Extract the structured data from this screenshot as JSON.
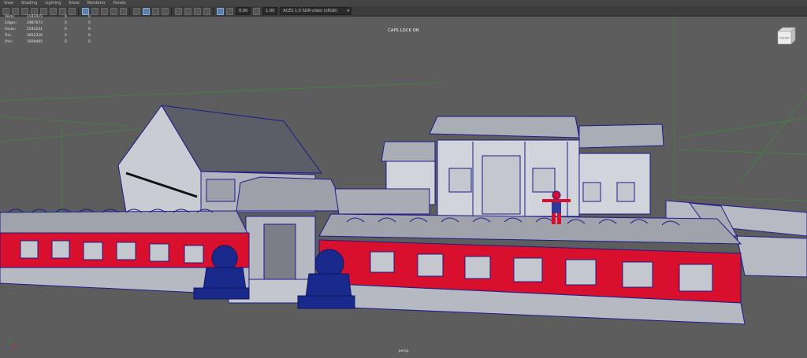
{
  "menu": [
    "View",
    "Shading",
    "Lighting",
    "Show",
    "Renderer",
    "Panels"
  ],
  "toolbar": {
    "field_a": "0.00",
    "field_b": "1.00",
    "color_space": "ACES 1.0 SDR-video (sRGB)",
    "icons": [
      "camera-icon",
      "grid-icon",
      "bookmark-icon",
      "image-plane-icon",
      "film-gate-icon",
      "resolution-gate-icon",
      "safe-action-icon",
      "field-chart-icon",
      "wireframe-icon",
      "smooth-shade-icon",
      "textured-icon",
      "lights-icon",
      "shadows-icon",
      "ambient-occlusion-icon",
      "motion-blur-icon",
      "antialias-icon",
      "isolate-select-icon",
      "xray-icon",
      "xray-joints-icon",
      "backface-icon",
      "exposure-icon",
      "gamma-icon",
      "color-manage-icon"
    ]
  },
  "hud": {
    "rows": [
      {
        "label": "Verts:",
        "v1": "1542415",
        "v2": "0",
        "v3": "0"
      },
      {
        "label": "Edges:",
        "v1": "2987673",
        "v2": "0",
        "v3": "0"
      },
      {
        "label": "Faces:",
        "v1": "1545241",
        "v2": "0",
        "v3": "0"
      },
      {
        "label": "Tris:",
        "v1": "3052316",
        "v2": "0",
        "v3": "0"
      },
      {
        "label": "UVs:",
        "v1": "1600465",
        "v2": "0",
        "v3": "0"
      }
    ]
  },
  "caps_lock": "CAPS LOCK ON",
  "camera_name": "persp",
  "viewcube_label": "FRONT",
  "colors": {
    "background": "#5d5d5d",
    "wire": "#1c1c8a",
    "wall_red": "#d8102e",
    "stone": "#b9bcc4",
    "statue": "#1a2a8c",
    "grid_green": "#3f8a3f"
  }
}
